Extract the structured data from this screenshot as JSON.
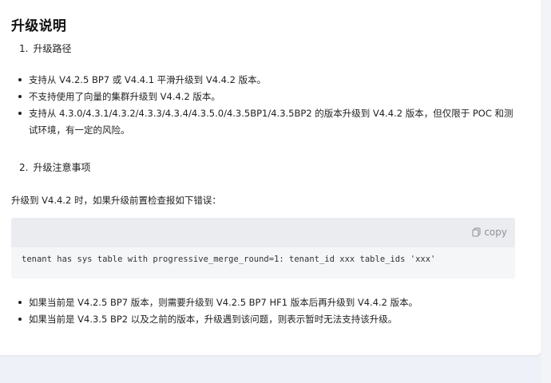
{
  "title": "升级说明",
  "section1": {
    "number": "1.",
    "heading": "升级路径",
    "items": [
      "支持从 V4.2.5 BP7 或 V4.4.1 平滑升级到 V4.4.2 版本。",
      "不支持使用了向量的集群升级到 V4.4.2 版本。",
      "支持从 4.3.0/4.3.1/4.3.2/4.3.3/4.3.4/4.3.5.0/4.3.5BP1/4.3.5BP2 的版本升级到 V4.4.2 版本，但仅限于 POC 和测试环境，有一定的风险。"
    ]
  },
  "section2": {
    "number": "2.",
    "heading": "升级注意事项",
    "paragraph": "升级到 V4.4.2 时，如果升级前置检查报如下错误：",
    "code": {
      "copy_label": "copy",
      "content": "tenant has sys table with progressive_merge_round=1: tenant_id xxx table_ids 'xxx'"
    },
    "items": [
      "如果当前是 V4.2.5 BP7 版本，则需要升级到 V4.2.5 BP7 HF1 版本后再升级到 V4.4.2 版本。",
      "如果当前是 V4.3.5 BP2 以及之前的版本，升级遇到该问题，则表示暂时无法支持该升级。"
    ]
  },
  "icons": {
    "copy": "copy-icon"
  }
}
